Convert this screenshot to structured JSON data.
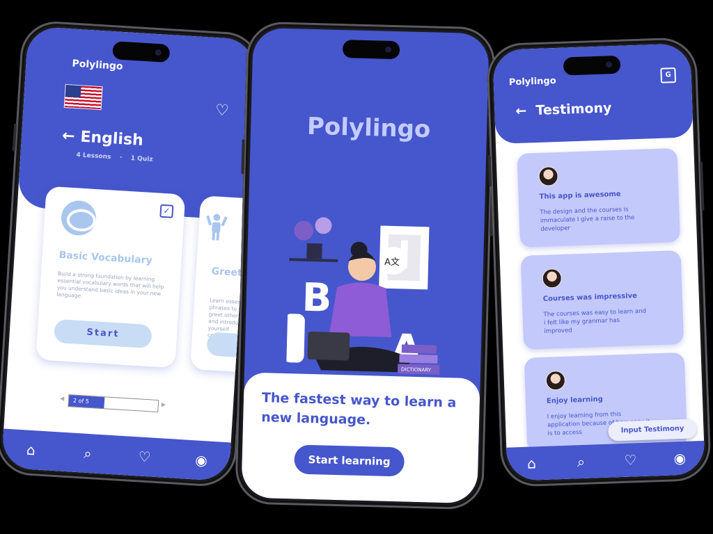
{
  "phone1": {
    "brand": "Polylingo",
    "course": {
      "title": "English",
      "lessons": "4 Lessons",
      "dot": "·",
      "quizzes": "1 Quiz"
    },
    "card1": {
      "title": "Basic Vocabulary",
      "description": "Build a strong foundation by learning essential vocabulary words that will help you understand basic ideas in your new language.",
      "button": "Start",
      "checked": true
    },
    "card2": {
      "title": "Greetings & Introductions",
      "description": "Learn essential phrases to greet others and introduce yourself confidently."
    },
    "progress": {
      "label": "2 of 5",
      "current": 2,
      "total": 5
    },
    "nav": [
      "home-icon",
      "search-icon",
      "heart-icon",
      "profile-icon"
    ]
  },
  "phone2": {
    "brand": "Polylingo",
    "illustration_letters": [
      "B",
      "A"
    ],
    "book_labels": [
      "DICTIONARY"
    ],
    "translate_glyph": "A文",
    "tagline": "The fastest way to learn a new language.",
    "cta": "Start learning"
  },
  "phone3": {
    "brand": "Polylingo",
    "title": "Testimony",
    "testimonials": [
      {
        "title": "This app is awesome",
        "body": "The design and the courses is immaculate I give a raise to the developer"
      },
      {
        "title": "Courses was impressive",
        "body": "The courses was easy to learn and i felt like my granmar has improved"
      },
      {
        "title": "Enjoy learning",
        "body": "I enjoy learning from this application because of how easy it is to access"
      }
    ],
    "input_button": "Input Testimony",
    "nav": [
      "home-icon",
      "search-icon",
      "heart-icon",
      "profile-icon"
    ]
  },
  "colors": {
    "primary": "#4656cc",
    "light_card": "#c3c9fb",
    "muted_blue": "#a9c6ee",
    "background": "#000000"
  }
}
